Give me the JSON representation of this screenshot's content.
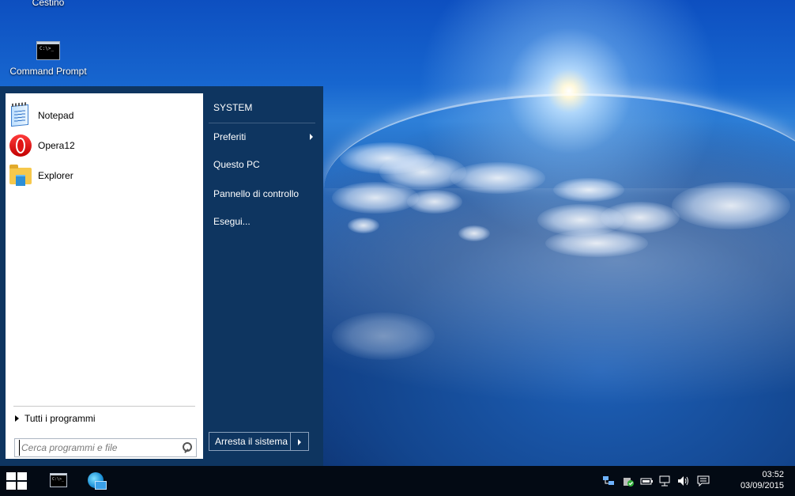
{
  "desktop": {
    "icons": [
      {
        "label": "Cestino",
        "icon": "recycle-bin-icon"
      },
      {
        "label": "Command Prompt",
        "icon": "command-prompt-icon"
      }
    ],
    "cmd_glyph": "C:\\>_"
  },
  "start_menu": {
    "programs": [
      {
        "label": "Notepad",
        "icon": "notepad-icon"
      },
      {
        "label": "Opera12",
        "icon": "opera-icon"
      },
      {
        "label": "Explorer",
        "icon": "folder-icon"
      }
    ],
    "all_programs_label": "Tutti i programmi",
    "search": {
      "placeholder": "Cerca programmi e file",
      "value": ""
    },
    "right_items": [
      {
        "label": "SYSTEM"
      },
      {
        "label": "Preferiti",
        "has_submenu": true
      },
      {
        "label": "Questo PC"
      },
      {
        "label": "Pannello di controllo"
      },
      {
        "label": "Esegui..."
      }
    ],
    "shutdown_label": "Arresta il sistema"
  },
  "taskbar": {
    "start_icon": "windows-logo-icon",
    "pinned": [
      {
        "icon": "command-prompt-icon"
      },
      {
        "icon": "internet-explorer-icon"
      }
    ],
    "tray_icons": [
      "network-icon",
      "security-icon",
      "battery-icon",
      "network-connection-icon",
      "volume-icon",
      "action-center-icon"
    ],
    "clock": {
      "time": "03:52",
      "date": "03/09/2015"
    }
  },
  "colors": {
    "start_menu_bg": "#0e3560",
    "taskbar_bg": "#030a14",
    "left_pane_bg": "#ffffff"
  }
}
